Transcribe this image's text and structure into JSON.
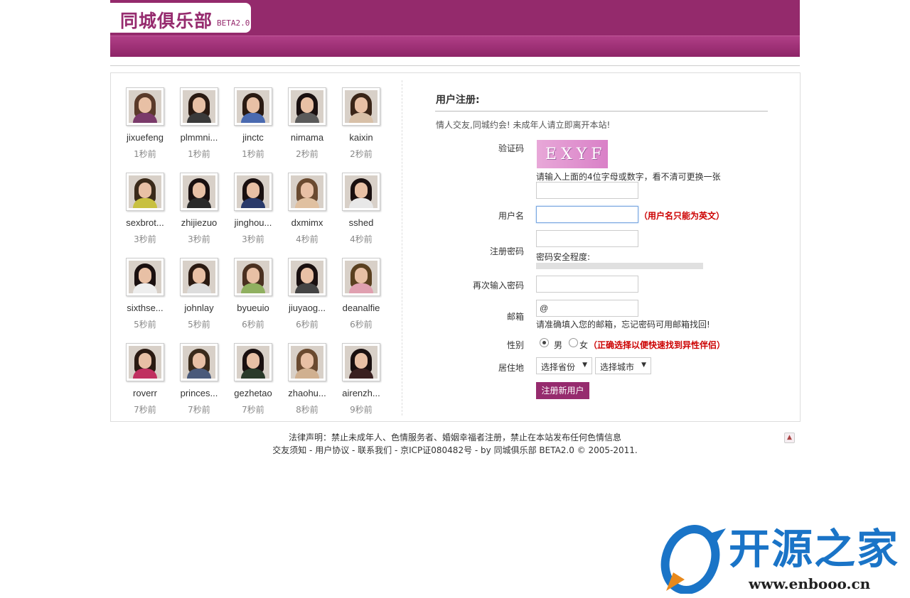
{
  "header": {
    "logo_text": "同城俱乐部",
    "logo_beta": "BETA2.0",
    "brand_color": "#962b6e"
  },
  "members": [
    {
      "name": "jixuefeng",
      "time": "1秒前",
      "hair": "#5a3a2a",
      "body": "#7a3a6a"
    },
    {
      "name": "plmmni...",
      "time": "1秒前",
      "hair": "#2a1a12",
      "body": "#3a3a3a"
    },
    {
      "name": "jinctc",
      "time": "1秒前",
      "hair": "#2a1a12",
      "body": "#4a6ab0"
    },
    {
      "name": "nimama",
      "time": "2秒前",
      "hair": "#1a1010",
      "body": "#5a5a5a"
    },
    {
      "name": "kaixin",
      "time": "2秒前",
      "hair": "#3a2518",
      "body": "#d8c0a8"
    },
    {
      "name": "sexbrot...",
      "time": "3秒前",
      "hair": "#3a2a1a",
      "body": "#c8c040"
    },
    {
      "name": "zhijiezuo",
      "time": "3秒前",
      "hair": "#1a1010",
      "body": "#2a2a2a"
    },
    {
      "name": "jinghou...",
      "time": "3秒前",
      "hair": "#1a1010",
      "body": "#2a3a6a"
    },
    {
      "name": "dxmimx",
      "time": "4秒前",
      "hair": "#6a4a30",
      "body": "#e0c0a0"
    },
    {
      "name": "sshed",
      "time": "4秒前",
      "hair": "#1a1010",
      "body": "#e8e8e8"
    },
    {
      "name": "sixthse...",
      "time": "5秒前",
      "hair": "#1a1010",
      "body": "#eeeeee"
    },
    {
      "name": "johnlay",
      "time": "5秒前",
      "hair": "#2a1a12",
      "body": "#dddddd"
    },
    {
      "name": "byueuio",
      "time": "6秒前",
      "hair": "#4a3020",
      "body": "#90b060"
    },
    {
      "name": "jiuyaog...",
      "time": "6秒前",
      "hair": "#1a1010",
      "body": "#444444"
    },
    {
      "name": "deanalfie",
      "time": "6秒前",
      "hair": "#5a4020",
      "body": "#e0a0b0"
    },
    {
      "name": "roverr",
      "time": "7秒前",
      "hair": "#2a1a12",
      "body": "#c03060"
    },
    {
      "name": "princes...",
      "time": "7秒前",
      "hair": "#3a2a1a",
      "body": "#4a5a7a"
    },
    {
      "name": "gezhetao",
      "time": "7秒前",
      "hair": "#1a1010",
      "body": "#2a3a2a"
    },
    {
      "name": "zhaohu...",
      "time": "8秒前",
      "hair": "#6a4a30",
      "body": "#d0b090"
    },
    {
      "name": "airenzh...",
      "time": "9秒前",
      "hair": "#1a1010",
      "body": "#3a2020"
    }
  ],
  "register": {
    "title": "用户注册:",
    "notice": "情人交友,同城约会! 未成年人请立即离开本站!",
    "captcha_label": "验证码",
    "captcha_text": "EXYF",
    "captcha_hint": "请输入上面的4位字母或数字，看不清可更换一张",
    "captcha_value": "",
    "username_label": "用户名",
    "username_value": "",
    "username_hint": "（用户名只能为英文）",
    "password_label": "注册密码",
    "password_value": "",
    "password_strength_label": "密码安全程度:",
    "password_strength": 0,
    "confirm_label": "再次输入密码",
    "confirm_value": "",
    "email_label": "邮箱",
    "email_value": "@",
    "email_hint": "请准确填入您的邮箱，忘记密码可用邮箱找回!",
    "gender_label": "性别",
    "gender_male": "男",
    "gender_female": "女",
    "gender_selected": "男",
    "gender_hint": "（正确选择以便快速找到异性伴侣）",
    "location_label": "居住地",
    "province_selected": "选择省份",
    "city_selected": "选择城市",
    "submit_label": "注册新用户"
  },
  "footer": {
    "legal": "法律声明：禁止未成年人、色情服务者、婚姻幸福者注册，禁止在本站发布任何色情信息",
    "links": "交友须知 - 用户协议 - 联系我们 - 京ICP证080482号 - by 同城俱乐部 BETA2.0 © 2005-2011.",
    "totop_icon": "arrow-up-icon"
  },
  "watermark": {
    "text": "开源之家",
    "url": "www.enbooo.cn",
    "color": "#1a74c7"
  }
}
